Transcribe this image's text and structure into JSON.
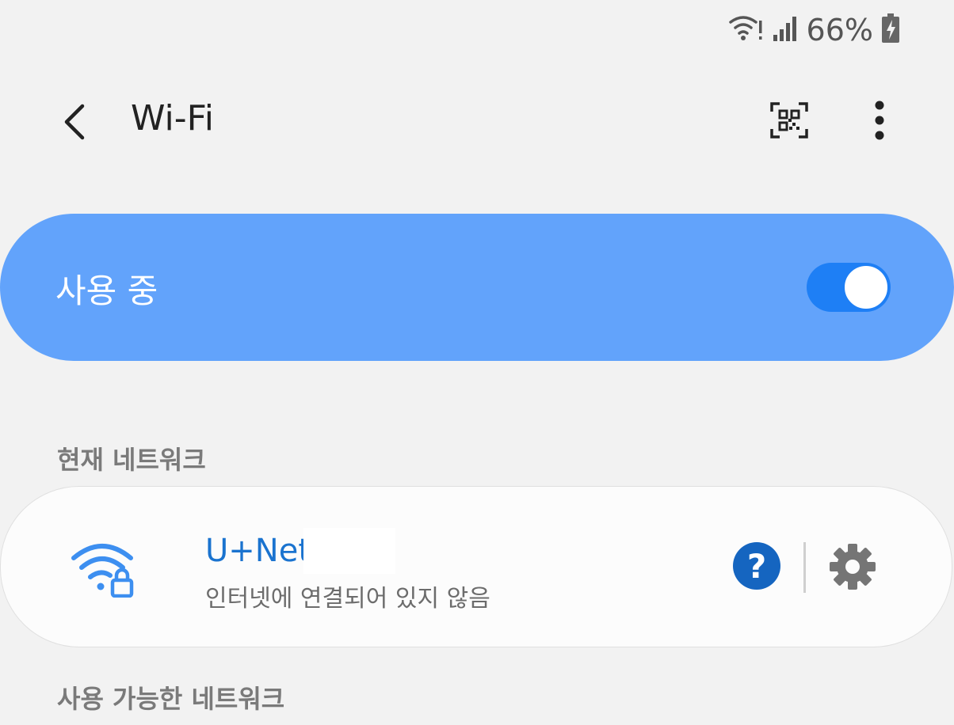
{
  "status_bar": {
    "battery_percent": "66%",
    "icons": [
      "wifi-alert-icon",
      "signal-icon",
      "battery-charging-icon"
    ]
  },
  "header": {
    "title": "Wi-Fi",
    "icons": [
      "back-arrow-icon",
      "qr-code-icon",
      "more-vert-icon"
    ]
  },
  "master_switch": {
    "label": "사용 중",
    "state": "on"
  },
  "current_network": {
    "section_title": "현재 네트워크",
    "name": "U+Net",
    "status": "인터넷에 연결되어 있지 않음",
    "icons": [
      "wifi-lock-icon",
      "help-icon",
      "settings-gear-icon"
    ]
  },
  "available_networks": {
    "section_title": "사용 가능한 네트워크"
  },
  "colors": {
    "background": "#f2f2f2",
    "master_switch_bg": "#62a3fb",
    "switch_track": "#1e7ff5",
    "network_name": "#1a73cf",
    "help_button": "#1565c0"
  }
}
